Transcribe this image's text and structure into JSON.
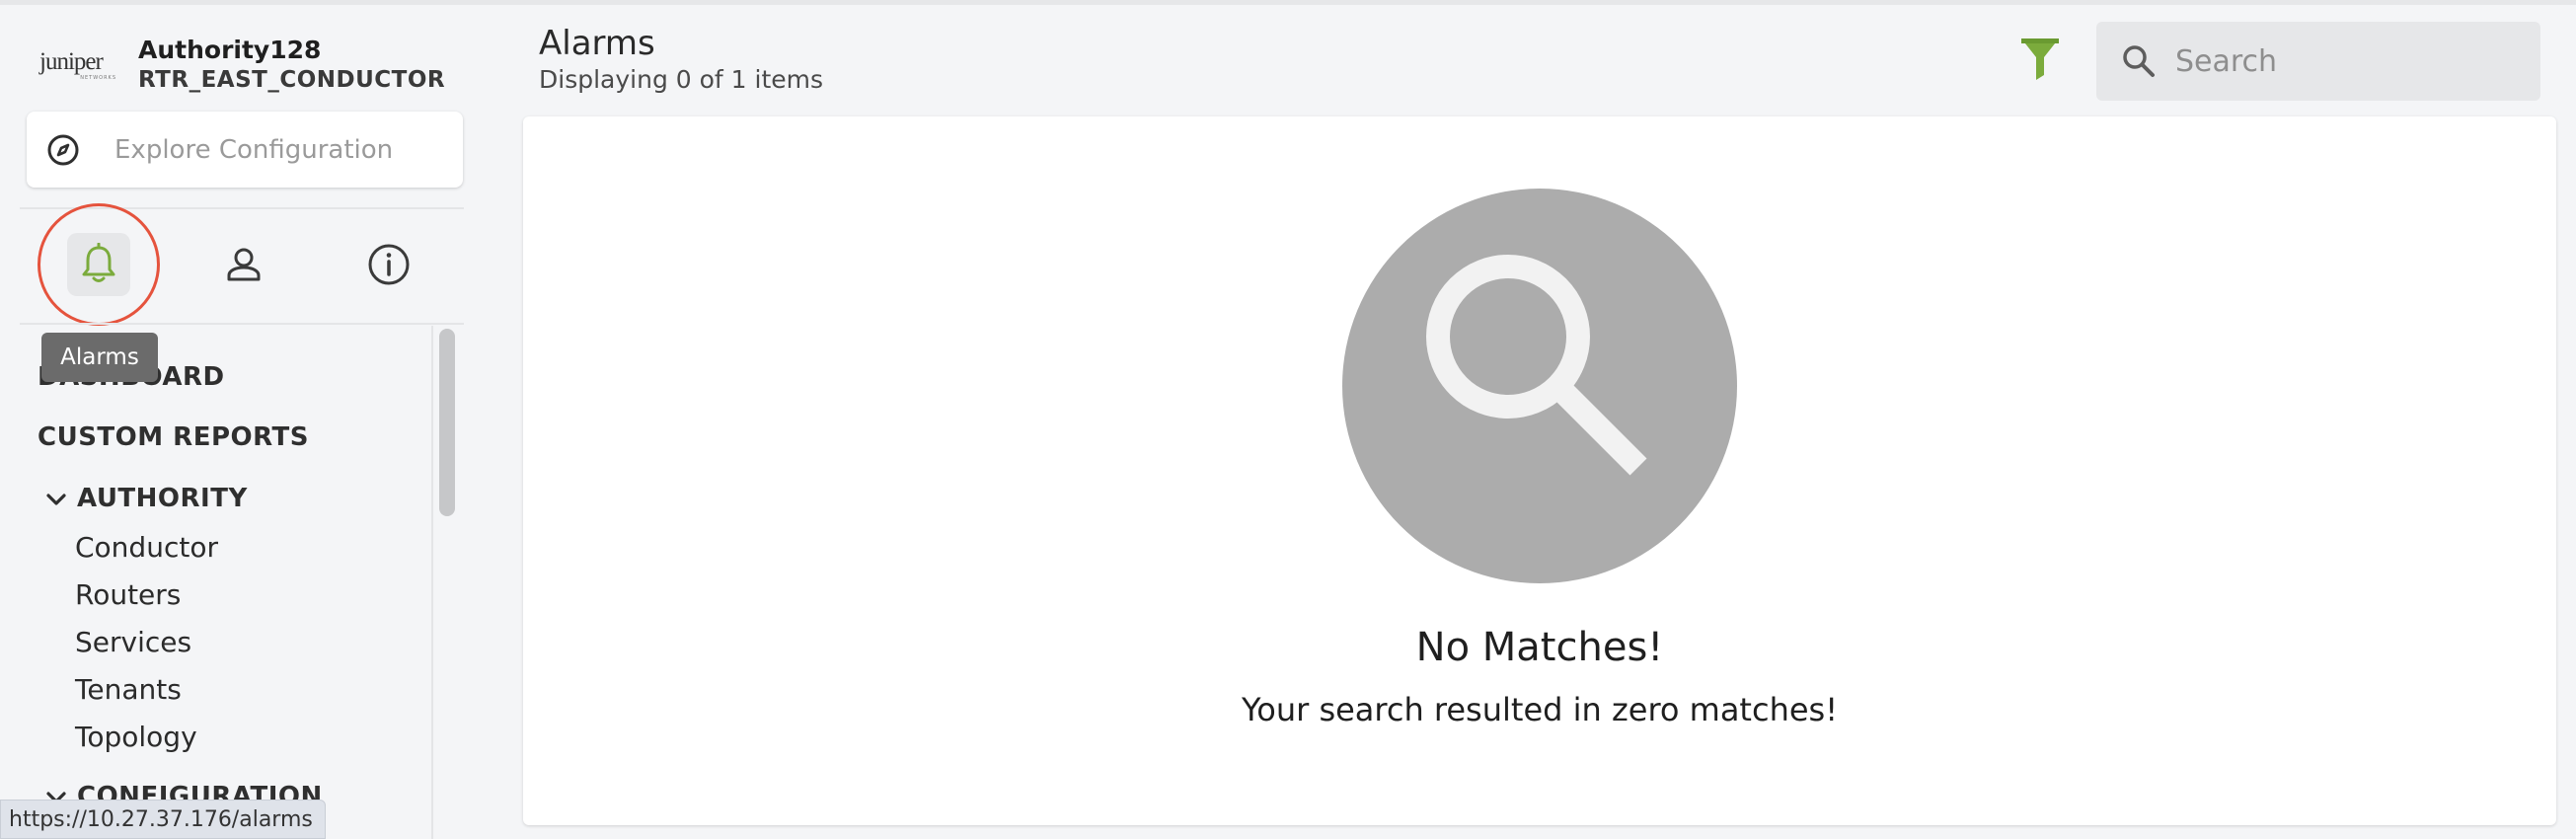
{
  "brand": {
    "logo_text": "JUNIPER",
    "logo_sub": "NETWORKS",
    "authority": "Authority128",
    "node": "RTR_EAST_CONDUCTOR"
  },
  "explore": {
    "placeholder": "Explore Configuration",
    "icon": "compass-icon"
  },
  "icon_bar": [
    {
      "name": "alarms",
      "icon": "bell-icon",
      "active": true
    },
    {
      "name": "user",
      "icon": "user-icon",
      "active": false
    },
    {
      "name": "info",
      "icon": "info-icon",
      "active": false
    }
  ],
  "tooltip": "Alarms",
  "nav": {
    "dashboard": "DASHBOARD",
    "custom_reports": "CUSTOM REPORTS",
    "authority": {
      "label": "AUTHORITY",
      "items": [
        "Conductor",
        "Routers",
        "Services",
        "Tenants",
        "Topology"
      ]
    },
    "configuration": "CONFIGURATION"
  },
  "url_hint": "https://10.27.37.176/alarms",
  "header": {
    "title": "Alarms",
    "subtitle": "Displaying 0 of 1 items",
    "search_placeholder": "Search"
  },
  "empty_state": {
    "title": "No Matches!",
    "message": "Your search resulted in zero matches!"
  },
  "colors": {
    "accent_green": "#7bab3c",
    "highlight_ring": "#e5533d",
    "empty_icon": "#acacac"
  }
}
